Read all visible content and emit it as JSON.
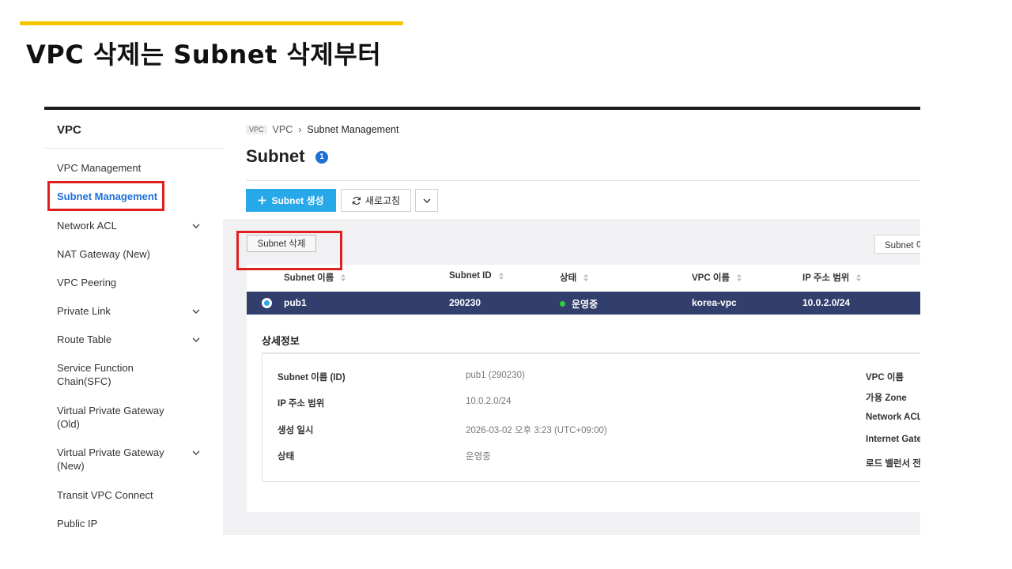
{
  "slide": {
    "title": "VPC 삭제는 Subnet 삭제부터",
    "accent_color": "#f5c400",
    "highlight_color": "#e01f1f"
  },
  "sidebar": {
    "header": "VPC",
    "items": [
      {
        "label": "VPC Management",
        "expandable": false,
        "active": false
      },
      {
        "label": "Subnet Management",
        "expandable": false,
        "active": true
      },
      {
        "label": "Network ACL",
        "expandable": true,
        "active": false
      },
      {
        "label": "NAT Gateway (New)",
        "expandable": false,
        "active": false
      },
      {
        "label": "VPC Peering",
        "expandable": false,
        "active": false
      },
      {
        "label": "Private Link",
        "expandable": true,
        "active": false
      },
      {
        "label": "Route Table",
        "expandable": true,
        "active": false
      },
      {
        "label": "Service Function Chain(SFC)",
        "expandable": false,
        "active": false
      },
      {
        "label": "Virtual Private Gateway (Old)",
        "expandable": false,
        "active": false
      },
      {
        "label": "Virtual Private Gateway (New)",
        "expandable": true,
        "active": false
      },
      {
        "label": "Transit VPC Connect",
        "expandable": false,
        "active": false
      },
      {
        "label": "Public IP",
        "expandable": false,
        "active": false
      }
    ]
  },
  "breadcrumb": {
    "tag": "VPC",
    "parent": "VPC",
    "current": "Subnet Management"
  },
  "page": {
    "title": "Subnet",
    "info_badge": "1"
  },
  "toolbar": {
    "create_label": "Subnet 생성",
    "refresh_label": "새로고침",
    "primary_color": "#27a8e8"
  },
  "panel": {
    "delete_label": "Subnet 삭제",
    "search_placeholder": "Subnet 이"
  },
  "table": {
    "columns": [
      "Subnet 이름",
      "Subnet ID",
      "상태",
      "VPC 이름",
      "IP 주소 범위"
    ],
    "rows": [
      {
        "name": "pub1",
        "id": "290230",
        "status": "운영중",
        "vpc": "korea-vpc",
        "ip_range": "10.0.2.0/24"
      }
    ],
    "selected_row_color": "#323e6c"
  },
  "details": {
    "title": "상세정보",
    "left": [
      {
        "label": "Subnet 이름 (ID)",
        "value": "pub1 (290230)"
      },
      {
        "label": "IP 주소 범위",
        "value": "10.0.2.0/24"
      },
      {
        "label": "생성 일시",
        "value": "2026-03-02 오후 3:23 (UTC+09:00)"
      },
      {
        "label": "상태",
        "value": "운영중"
      }
    ],
    "right": [
      {
        "label": "VPC 이름"
      },
      {
        "label": "가용 Zone"
      },
      {
        "label": "Network ACL"
      },
      {
        "label": "Internet Gatew"
      },
      {
        "label": "로드 밸런서 전용"
      }
    ]
  }
}
